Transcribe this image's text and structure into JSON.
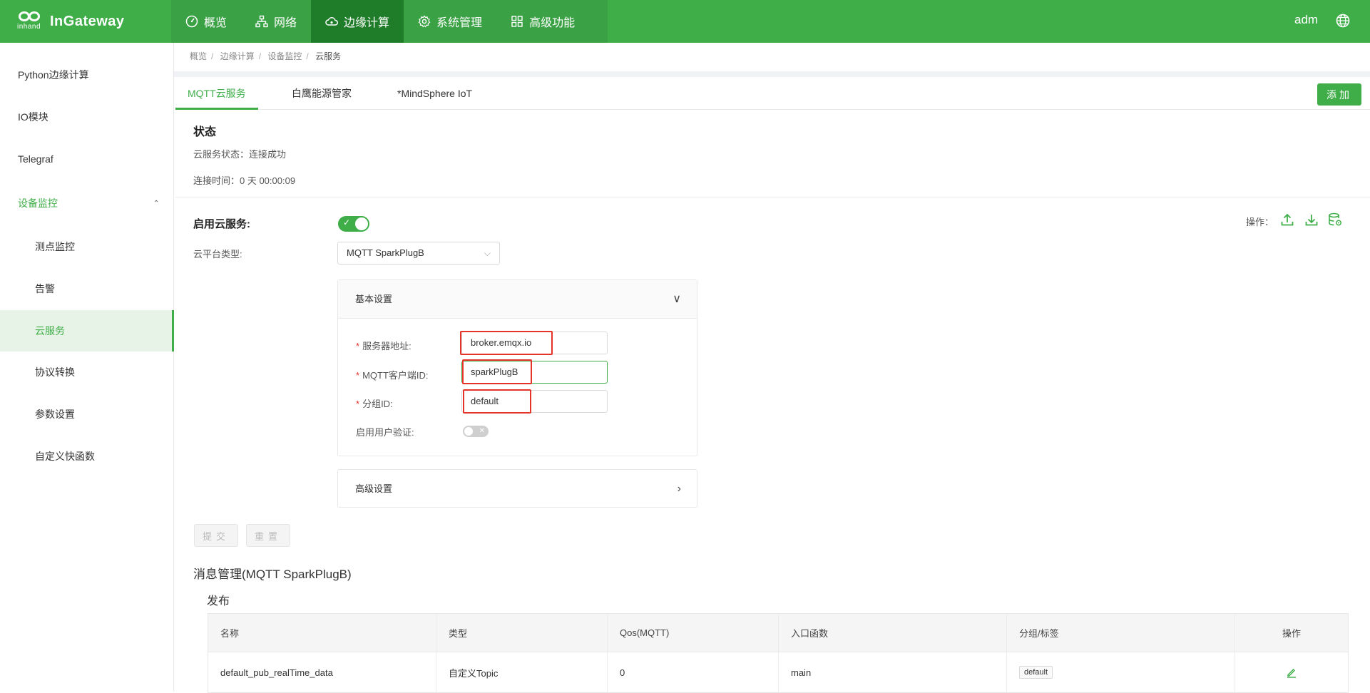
{
  "brand": {
    "logo_sub": "inhand",
    "logo_text": "InGateway"
  },
  "nav": [
    {
      "label": "概览",
      "icon": "gauge-icon"
    },
    {
      "label": "网络",
      "icon": "network-icon"
    },
    {
      "label": "边缘计算",
      "icon": "cloud-icon",
      "active": true
    },
    {
      "label": "系统管理",
      "icon": "gear-icon"
    },
    {
      "label": "高级功能",
      "icon": "grid-icon"
    }
  ],
  "user": {
    "name": "adm"
  },
  "sidebar": [
    {
      "label": "Python边缘计算"
    },
    {
      "label": "IO模块"
    },
    {
      "label": "Telegraf"
    },
    {
      "label": "设备监控",
      "expanded": true
    },
    {
      "label": "测点监控"
    },
    {
      "label": "告警"
    },
    {
      "label": "云服务",
      "selected": true
    },
    {
      "label": "协议转换"
    },
    {
      "label": "参数设置"
    },
    {
      "label": "自定义快函数"
    }
  ],
  "breadcrumb": [
    "概览",
    "边缘计算",
    "设备监控",
    "云服务"
  ],
  "tabs": [
    "MQTT云服务",
    "白鹰能源管家",
    "*MindSphere IoT"
  ],
  "add_button": "添加",
  "status": {
    "title": "状态",
    "cloud_status": "云服务状态：连接成功",
    "connect_time": "连接时间：0 天 00:00:09"
  },
  "enable_cloud": {
    "label": "启用云服务:",
    "value": true
  },
  "ops_label": "操作：",
  "platform": {
    "label": "云平台类型:",
    "value": "MQTT SparkPlugB"
  },
  "basic": {
    "title": "基本设置",
    "server": {
      "label": "服务器地址:",
      "value": "broker.emqx.io"
    },
    "client_id": {
      "label": "MQTT客户端ID:",
      "value": "sparkPlugB"
    },
    "group_id": {
      "label": "分组ID:",
      "value": "default"
    },
    "auth": {
      "label": "启用用户验证:",
      "value": false
    }
  },
  "advanced": {
    "title": "高级设置"
  },
  "buttons": {
    "submit": "提交",
    "reset": "重置"
  },
  "messages": {
    "title": "消息管理(MQTT SparkPlugB)",
    "publish": "发布",
    "columns": [
      "名称",
      "类型",
      "Qos(MQTT)",
      "入口函数",
      "分组/标签",
      "操作"
    ],
    "rows": [
      {
        "name": "default_pub_realTime_data",
        "type": "自定义Topic",
        "qos": "0",
        "entry": "main",
        "tag": "default"
      }
    ]
  },
  "colors": {
    "primary": "#3fae49",
    "nav_active": "#1f7d2a",
    "highlight": "#e5332a"
  }
}
